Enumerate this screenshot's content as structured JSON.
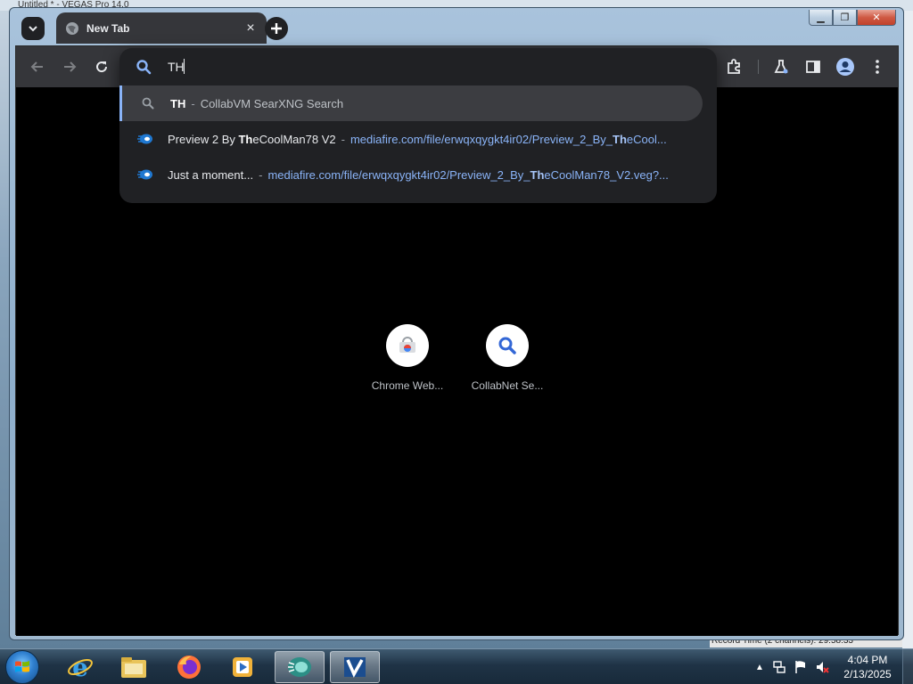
{
  "background": {
    "window_strip_text": "Untitled * - VEGAS Pro 14.0",
    "record_time_text": "Record Time (2 channels): 29:58:33"
  },
  "browser": {
    "tab": {
      "title": "New Tab",
      "close_icon": "close-icon"
    },
    "toolbar": {
      "back_icon": "arrow-left-icon",
      "forward_icon": "arrow-right-icon",
      "reload_icon": "reload-icon",
      "extensions_icon": "puzzle-icon",
      "labs_icon": "flask-icon",
      "side_panel_icon": "side-panel-icon",
      "profile_icon": "account-icon",
      "menu_icon": "three-dots-icon"
    },
    "omnibox": {
      "value": "TH",
      "suggestions": [
        {
          "match": "TH",
          "rest": "",
          "separator": "-",
          "description": "CollabVM SearXNG Search",
          "url": ""
        },
        {
          "prefix": "Preview 2 By ",
          "match": "Th",
          "rest": "eCoolMan78 V2",
          "separator": "-",
          "url_prefix": "mediafire.com/file/erwqxqygkt4ir02/Preview_2_By_",
          "url_match": "Th",
          "url_rest": "eCool..."
        },
        {
          "prefix": "Just a moment...",
          "match": "",
          "rest": "",
          "separator": "-",
          "url_prefix": "mediafire.com/file/erwqxqygkt4ir02/Preview_2_By_",
          "url_match": "Th",
          "url_rest": "eCoolMan78_V2.veg?..."
        }
      ]
    },
    "shortcuts": [
      {
        "label": "Chrome Web...",
        "icon": "chrome-web-store-icon"
      },
      {
        "label": "CollabNet Se...",
        "icon": "search-icon"
      }
    ]
  },
  "taskbar": {
    "clock_time": "4:04 PM",
    "clock_date": "2/13/2025"
  },
  "colors": {
    "accent": "#8ab4f8",
    "omnibox_bg": "#202124",
    "toolbar_bg": "#35363a"
  }
}
